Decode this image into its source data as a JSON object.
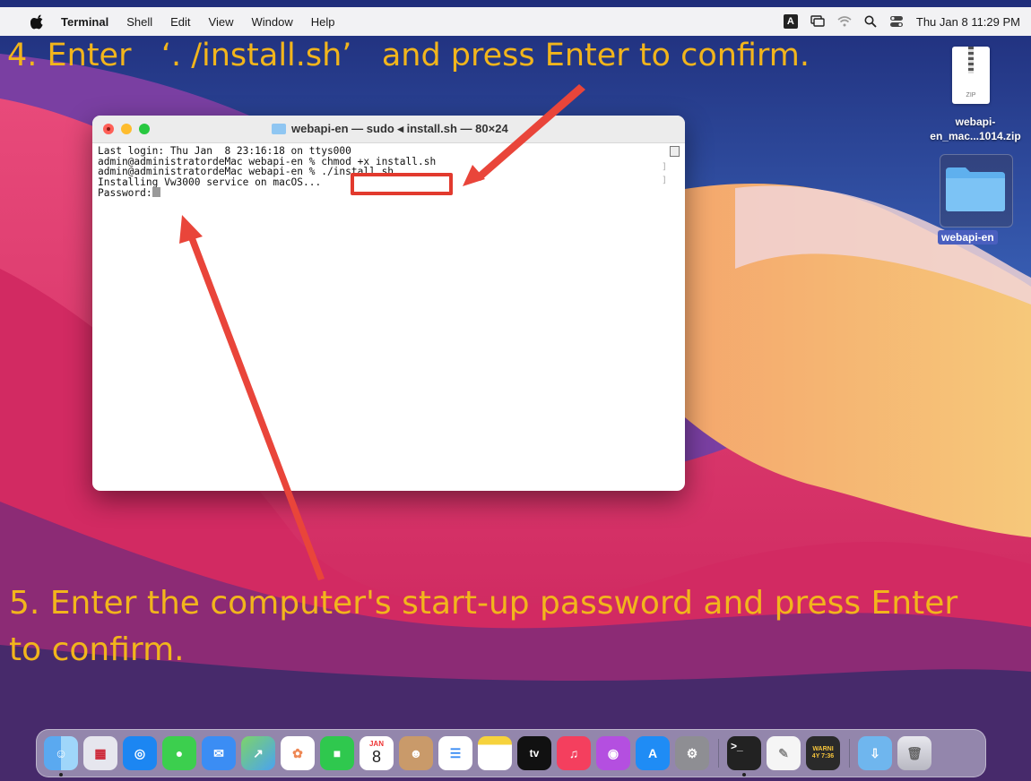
{
  "menubar": {
    "app_name": "Terminal",
    "menus": [
      "Shell",
      "Edit",
      "View",
      "Window",
      "Help"
    ],
    "input_source": "A",
    "clock": "Thu Jan 8  11:29 PM"
  },
  "captions": {
    "step4": "4. Enter   ‘. /install.sh’   and press Enter to confirm.",
    "step5": "5. Enter the computer's start-up password and press Enter to confirm."
  },
  "terminal": {
    "title": "webapi-en — sudo ◂ install.sh — 80×24",
    "lines": [
      "Last login: Thu Jan  8 23:16:18 on ttys000",
      "admin@administratordeMac webapi-en % chmod +x install.sh",
      "admin@administratordeMac webapi-en % ./install.sh",
      "Installing Vw3000 service on macOS...",
      "Password:"
    ]
  },
  "desktop": {
    "zip_icon_label": "ZIP",
    "zip_name": "webapi-\nen_mac...1014.zip",
    "folder_name": "webapi-en"
  },
  "dock": {
    "calendar_month": "JAN",
    "calendar_day": "8",
    "tv_label": "tv",
    "warning_app_text": "WARNI\n4Y 7:36",
    "items": [
      "finder-icon",
      "launchpad-icon",
      "safari-icon",
      "messages-icon",
      "mail-icon",
      "maps-icon",
      "photos-icon",
      "facetime-icon",
      "calendar-icon",
      "contacts-icon",
      "reminders-icon",
      "notes-icon",
      "apple-tv-icon",
      "music-icon",
      "podcasts-icon",
      "app-store-icon",
      "system-preferences-icon",
      "terminal-icon",
      "textedit-icon",
      "console-icon",
      "downloads-folder-icon",
      "trash-icon"
    ]
  }
}
